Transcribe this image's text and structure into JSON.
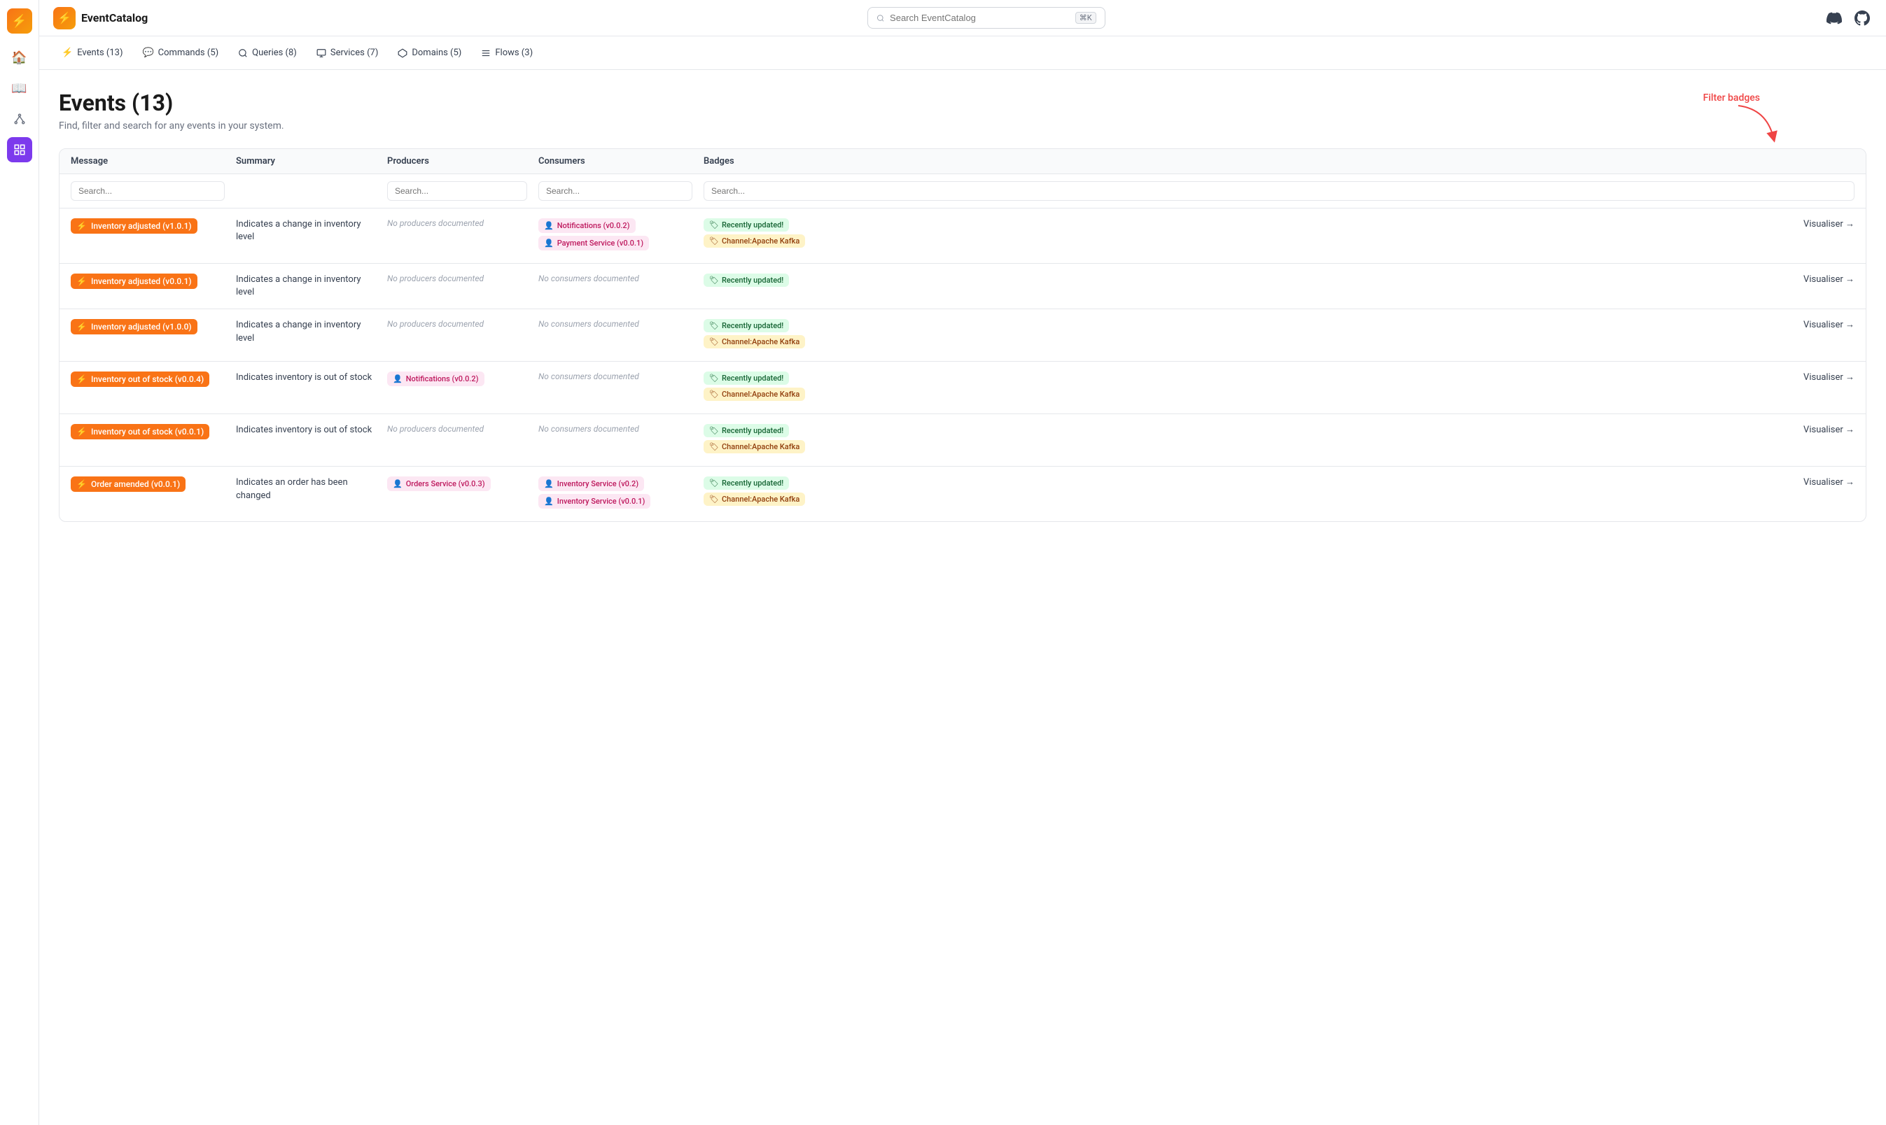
{
  "app": {
    "name": "EventCatalog"
  },
  "header": {
    "search_placeholder": "Search EventCatalog",
    "search_shortcut": "⌘K"
  },
  "nav_tabs": [
    {
      "id": "events",
      "label": "Events (13)",
      "icon": "⚡"
    },
    {
      "id": "commands",
      "label": "Commands (5)",
      "icon": "💬"
    },
    {
      "id": "queries",
      "label": "Queries (8)",
      "icon": "🔍"
    },
    {
      "id": "services",
      "label": "Services (7)",
      "icon": "🖥"
    },
    {
      "id": "domains",
      "label": "Domains (5)",
      "icon": "⬡"
    },
    {
      "id": "flows",
      "label": "Flows (3)",
      "icon": "☰"
    }
  ],
  "page": {
    "title": "Events (13)",
    "subtitle": "Find, filter and search for any events in your system."
  },
  "table": {
    "columns": [
      "Message",
      "Summary",
      "Producers",
      "Consumers",
      "Badges"
    ],
    "search_placeholders": [
      "Search...",
      "",
      "Search...",
      "Search...",
      "Search..."
    ],
    "rows": [
      {
        "message": "Inventory adjusted (v1.0.1)",
        "summary": "Indicates a change in inventory level",
        "producers": [],
        "producers_empty": "No producers documented",
        "consumers": [
          "Notifications (v0.0.2)",
          "Payment Service (v0.0.1)"
        ],
        "consumers_empty": "",
        "badges_green": [
          "Recently updated!"
        ],
        "badges_yellow": [
          "Channel:Apache Kafka"
        ],
        "visualiser": "Visualiser →"
      },
      {
        "message": "Inventory adjusted (v0.0.1)",
        "summary": "Indicates a change in inventory level",
        "producers": [],
        "producers_empty": "No producers documented",
        "consumers": [],
        "consumers_empty": "No consumers documented",
        "badges_green": [
          "Recently updated!"
        ],
        "badges_yellow": [],
        "visualiser": "Visualiser →"
      },
      {
        "message": "Inventory adjusted (v1.0.0)",
        "summary": "Indicates a change in inventory level",
        "producers": [],
        "producers_empty": "No producers documented",
        "consumers": [],
        "consumers_empty": "No consumers documented",
        "badges_green": [
          "Recently updated!"
        ],
        "badges_yellow": [
          "Channel:Apache Kafka"
        ],
        "visualiser": "Visualiser →"
      },
      {
        "message": "Inventory out of stock (v0.0.4)",
        "summary": "Indicates inventory is out of stock",
        "producers": [
          "Notifications (v0.0.2)"
        ],
        "producers_empty": "",
        "consumers": [],
        "consumers_empty": "No consumers documented",
        "badges_green": [
          "Recently updated!"
        ],
        "badges_yellow": [
          "Channel:Apache Kafka"
        ],
        "visualiser": "Visualiser →"
      },
      {
        "message": "Inventory out of stock (v0.0.1)",
        "summary": "Indicates inventory is out of stock",
        "producers": [],
        "producers_empty": "No producers documented",
        "consumers": [],
        "consumers_empty": "No consumers documented",
        "badges_green": [
          "Recently updated!"
        ],
        "badges_yellow": [
          "Channel:Apache Kafka"
        ],
        "visualiser": "Visualiser →"
      },
      {
        "message": "Order amended (v0.0.1)",
        "summary": "Indicates an order has been changed",
        "producers": [
          "Orders Service (v0.0.3)"
        ],
        "producers_empty": "",
        "consumers": [
          "Inventory Service (v0.2)",
          "Inventory Service (v0.0.1)"
        ],
        "consumers_empty": "",
        "badges_green": [
          "Recently updated!"
        ],
        "badges_yellow": [
          "Channel:Apache Kafka"
        ],
        "visualiser": "Visualiser →"
      }
    ]
  },
  "annotation": {
    "label": "Filter badges"
  },
  "sidebar": {
    "items": [
      {
        "id": "home",
        "icon": "🏠"
      },
      {
        "id": "book",
        "icon": "📖"
      },
      {
        "id": "nodes",
        "icon": "⬡"
      },
      {
        "id": "grid",
        "icon": "▦"
      }
    ]
  }
}
